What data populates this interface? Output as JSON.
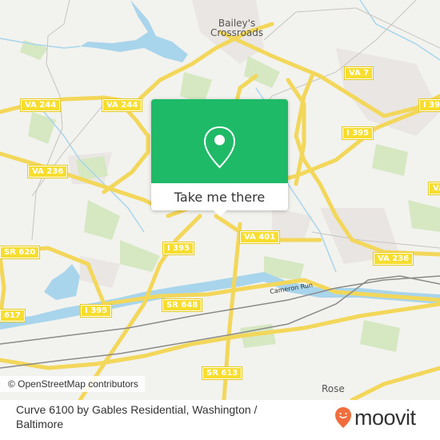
{
  "map": {
    "place_labels": [
      "Bailey's\nCrossroads",
      "Rose"
    ],
    "stream_label": "Cameron Run",
    "road_shields": [
      {
        "id": "va244-a",
        "label": "VA 244"
      },
      {
        "id": "va244-b",
        "label": "VA 244"
      },
      {
        "id": "va7",
        "label": "VA 7"
      },
      {
        "id": "i395-ne",
        "label": "I 395"
      },
      {
        "id": "i395-mid",
        "label": "I 395"
      },
      {
        "id": "va236-w",
        "label": "VA 236"
      },
      {
        "id": "va236-e",
        "label": "VA 236"
      },
      {
        "id": "va-e-edge",
        "label": "VA"
      },
      {
        "id": "i395-w",
        "label": "I 395"
      },
      {
        "id": "va401",
        "label": "VA 401"
      },
      {
        "id": "sr620",
        "label": "SR 620"
      },
      {
        "id": "i395-sw",
        "label": "I 395"
      },
      {
        "id": "sr648",
        "label": "SR 648"
      },
      {
        "id": "sr617",
        "label": "617"
      },
      {
        "id": "sr613",
        "label": "SR 613"
      }
    ],
    "attribution": "© OpenStreetMap contributors"
  },
  "popup": {
    "icon": "map-pin-icon",
    "button_label": "Take me there",
    "accent_color": "#1fba68"
  },
  "footer": {
    "title": "Curve 6100 by Gables Residential, Washington / Baltimore",
    "brand": "moovit",
    "brand_color": "#f26d3d"
  }
}
